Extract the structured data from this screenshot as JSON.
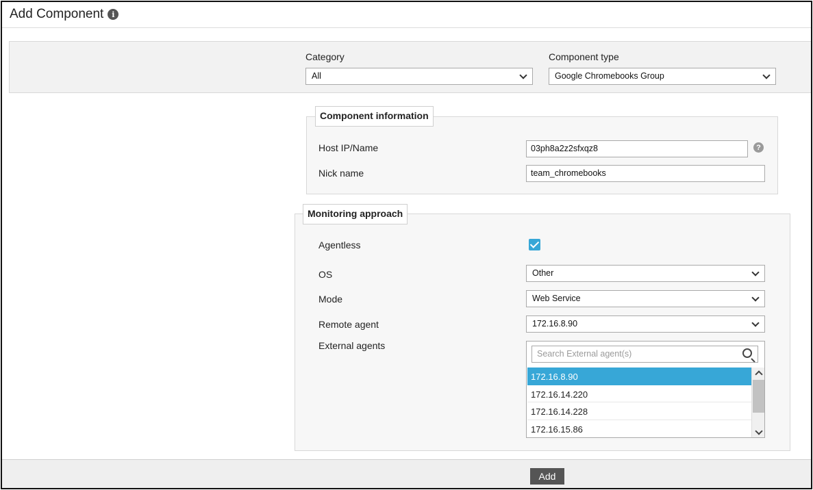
{
  "page": {
    "title": "Add Component"
  },
  "category": {
    "label": "Category",
    "value": "All"
  },
  "component_type": {
    "label": "Component type",
    "value": "Google Chromebooks Group"
  },
  "component_information": {
    "legend": "Component information",
    "host_label": "Host IP/Name",
    "host_value": "03ph8a2z2sfxqz8",
    "nick_label": "Nick name",
    "nick_value": "team_chromebooks"
  },
  "monitoring": {
    "legend": "Monitoring approach",
    "agentless_label": "Agentless",
    "agentless_checked": true,
    "os_label": "OS",
    "os_value": "Other",
    "mode_label": "Mode",
    "mode_value": "Web Service",
    "remote_label": "Remote agent",
    "remote_value": "172.16.8.90",
    "external_label": "External agents",
    "search_placeholder": "Search External agent(s)",
    "external_agents": [
      "172.16.8.90",
      "172.16.14.220",
      "172.16.14.228",
      "172.16.15.86"
    ],
    "selected_agent": "172.16.8.90"
  },
  "footer": {
    "add_label": "Add"
  },
  "icons": {
    "info": "info-icon",
    "help": "question-icon",
    "search": "search-icon",
    "chevron": "chevron-down-icon"
  },
  "colors": {
    "accent": "#37a7d7",
    "button": "#555555"
  }
}
